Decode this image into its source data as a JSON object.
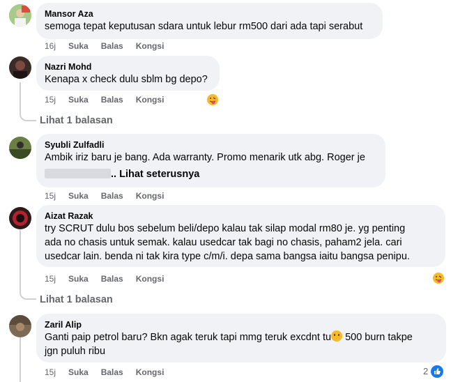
{
  "comments": [
    {
      "name": "Mansor Aza",
      "lines": [
        "semoga tepat keputusan sdara untuk lebur rm500 dari ada tapi serabut"
      ],
      "time": "16j",
      "like": "Suka",
      "reply": "Balas",
      "share": "Kongsi"
    },
    {
      "name": "Nazri Mohd",
      "lines": [
        "Kenapa x check dulu sblm bg depo?"
      ],
      "time": "15j",
      "like": "Suka",
      "reply": "Balas",
      "share": "Kongsi",
      "reaction_icon": "tongue-face-emoji-icon",
      "replies_label": "Lihat 1 balasan"
    },
    {
      "name": "Syubli Zulfadli",
      "lines": [
        "Ambik iriz baru je bang. Ada warranty. Promo menarik utk abg. Roger je"
      ],
      "see_more": "Lihat seterusnya",
      "time": "15j",
      "like": "Suka",
      "reply": "Balas",
      "share": "Kongsi"
    },
    {
      "name": "Aizat Razak",
      "lines": [
        "try SCRUT dulu bos sebelum beli/depo kalau tak silap modal rm80 je. yg penting",
        "ada no chasis untuk semak. kalau usedcar tak bagi no chasis, paham2 jela. cari",
        "usedcar lain. benda ni tak kira type c/m/i. depa sama bangsa iaitu bangsa penipu."
      ],
      "time": "15j",
      "like": "Suka",
      "reply": "Balas",
      "share": "Kongsi",
      "reaction_icon": "tongue-face-emoji-icon",
      "replies_label": "Lihat 1 balasan"
    },
    {
      "name": "Zaril Alip",
      "line1_before": "Ganti paip petrol baru? Bkn agak teruk tapi mmg teruk excdnt tu",
      "line1_after": " 500 burn takpe",
      "lines": [
        "jgn puluh ribu"
      ],
      "time": "15j",
      "like": "Suka",
      "reply": "Balas",
      "share": "Kongsi",
      "like_count": "2",
      "reaction_icon": "like-icon"
    }
  ],
  "colors": {
    "bubble": "#f0f2f5",
    "secondary_text": "#65676b",
    "like_blue": "#1877f2",
    "emoji_yellow": "#f7b928"
  }
}
